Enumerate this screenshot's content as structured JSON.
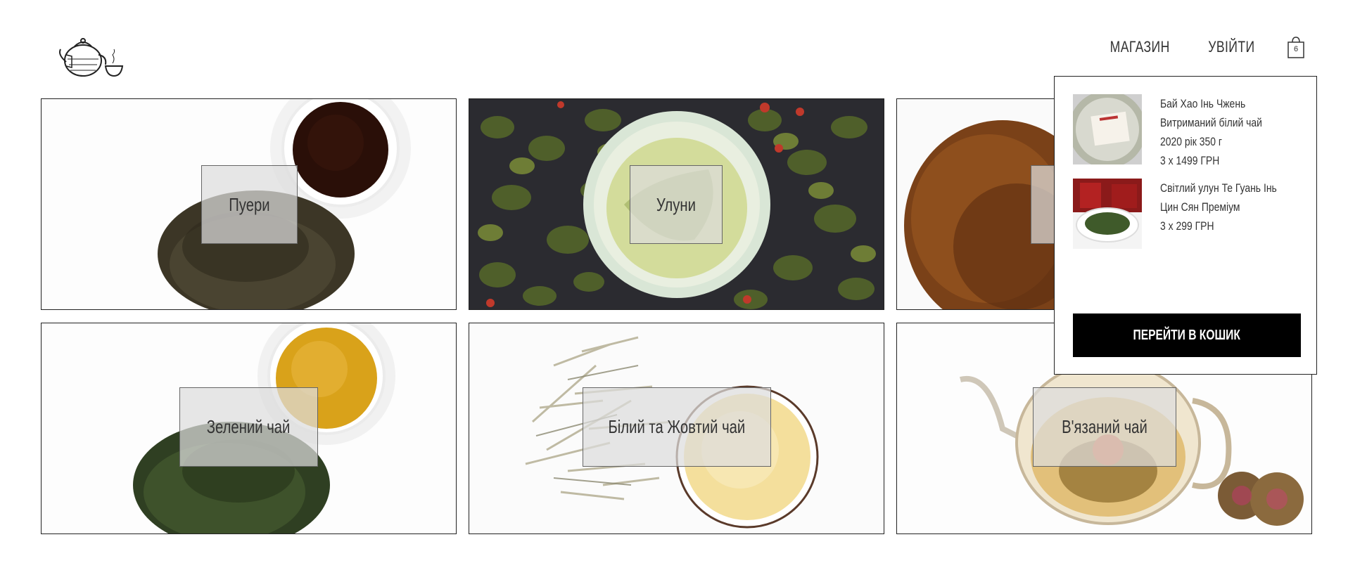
{
  "header": {
    "logo_alt": "teapot-logo",
    "nav": [
      {
        "label": "МАГАЗИН"
      },
      {
        "label": "УВІЙТИ"
      }
    ],
    "cart_count": "6"
  },
  "categories": [
    {
      "label": "Пуери"
    },
    {
      "label": "Улуни"
    },
    {
      "label": ""
    },
    {
      "label": "Зелений чай"
    },
    {
      "label": "Білий та Жовтий чай"
    },
    {
      "label": "В'язаний чай"
    }
  ],
  "cart": {
    "items": [
      {
        "title_lines": [
          "Бай Хао Інь Чжень",
          "Витриманий білий чай",
          "2020 рік 350 г"
        ],
        "qty_price": "3 x 1499 ГРН"
      },
      {
        "title_lines": [
          "Світлий улун Те Гуань Інь",
          "Цин Сян Преміум"
        ],
        "qty_price": "3 x 299 ГРН"
      }
    ],
    "checkout_label": "ПЕРЕЙТИ В КОШИК"
  },
  "colors": {
    "border": "#222222",
    "label_bg": "rgba(220,220,220,0.72)",
    "button_bg": "#000000",
    "button_text": "#ffffff"
  }
}
